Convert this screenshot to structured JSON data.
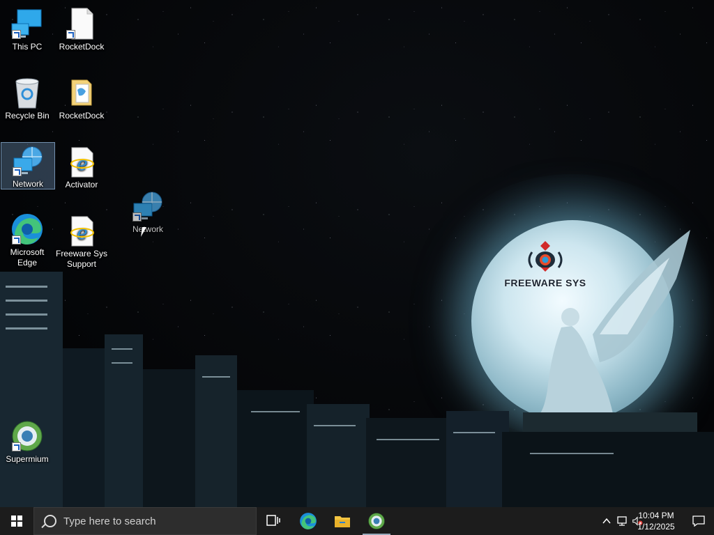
{
  "desktop": {
    "icons": [
      {
        "label": "This PC"
      },
      {
        "label": "RocketDock"
      },
      {
        "label": "Recycle Bin"
      },
      {
        "label": "RocketDock"
      },
      {
        "label": "Network"
      },
      {
        "label": "Activator"
      },
      {
        "label": "Microsoft Edge"
      },
      {
        "label": "Freeware Sys Support"
      },
      {
        "label": "Supermium"
      }
    ],
    "dragged_icon": {
      "label": "Network"
    }
  },
  "wallpaper": {
    "logo_text": "FREEWARE SYS"
  },
  "taskbar": {
    "search_placeholder": "Type here to search",
    "pinned": [
      "task-view-icon",
      "edge-icon",
      "file-explorer-icon",
      "supermium-icon"
    ],
    "clock_time": "10:04 PM",
    "clock_date": "1/12/2025",
    "accent": "#1c1c1c"
  }
}
